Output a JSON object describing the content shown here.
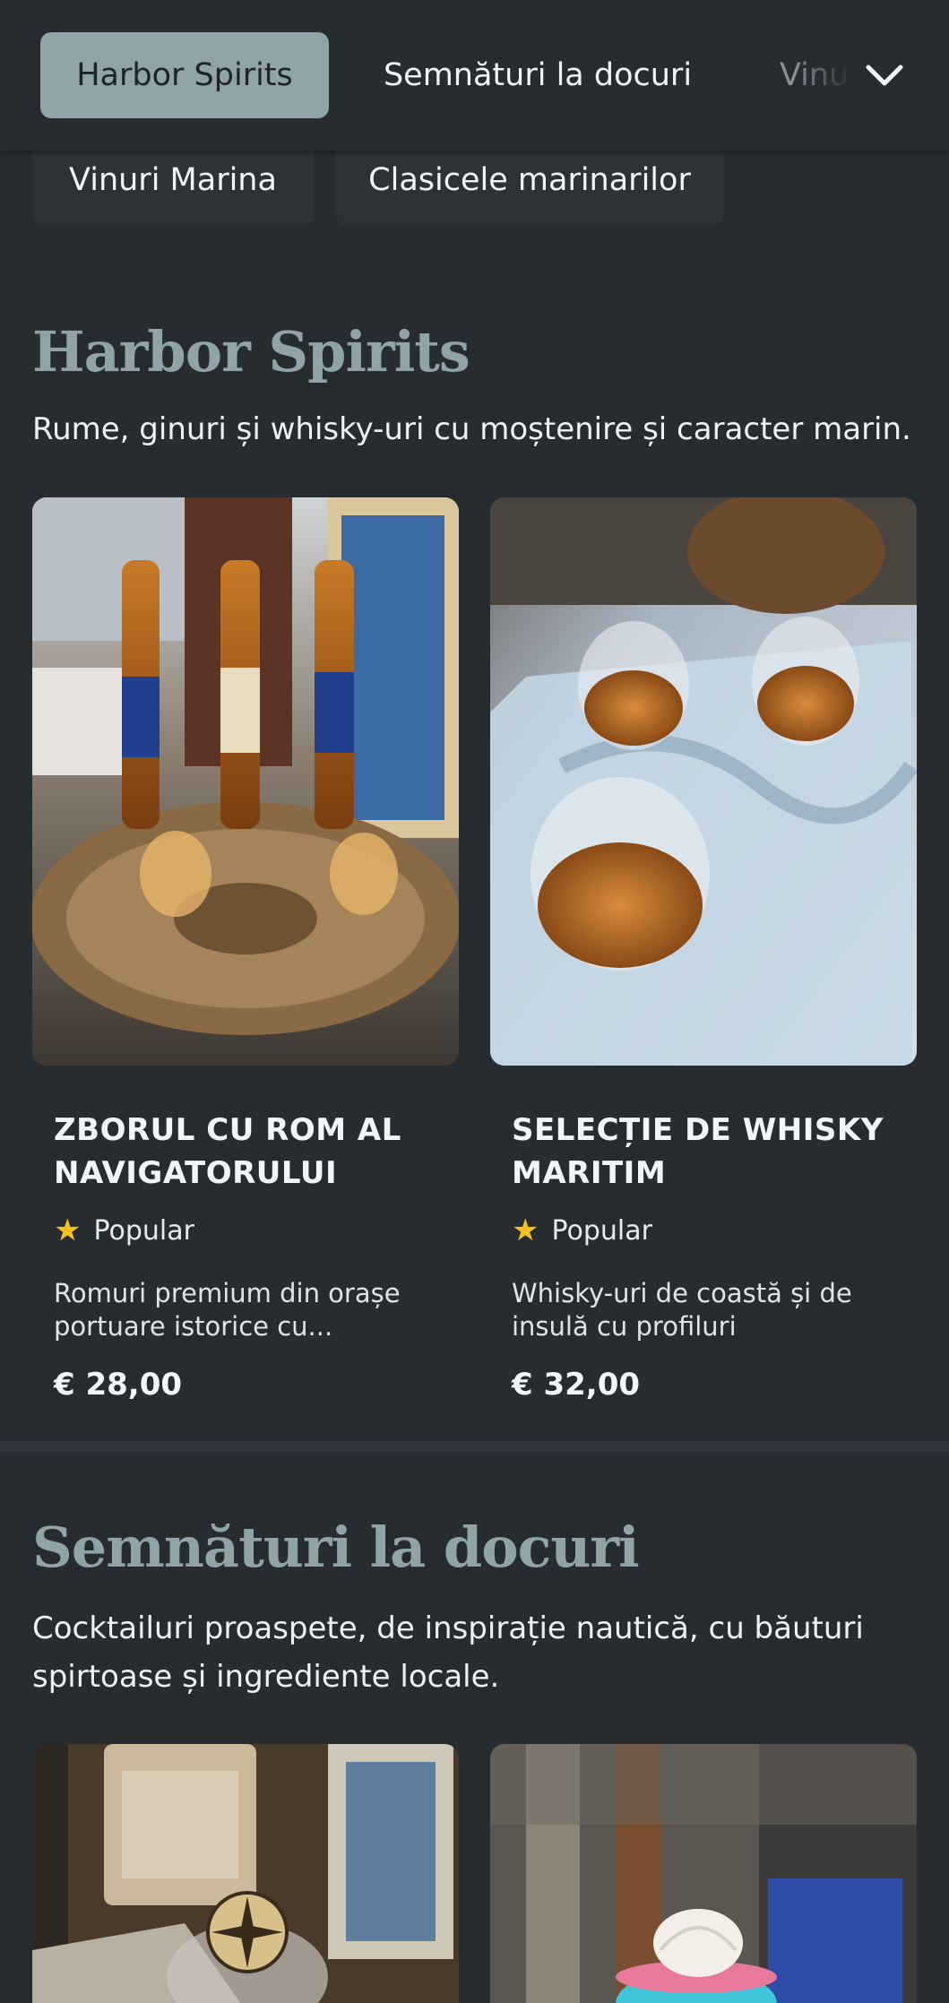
{
  "nav": {
    "tabs": [
      {
        "label": "Harbor Spirits",
        "active": true
      },
      {
        "label": "Semnături la docuri",
        "active": false
      },
      {
        "label": "Vinuri Marina",
        "active": false
      }
    ],
    "overflow_tabs": [
      "Vinuri Marina",
      "Clasicele marinarilor"
    ],
    "expand_icon": "chevron-down-icon"
  },
  "sections": [
    {
      "title": "Harbor Spirits",
      "description": "Rume, ginuri și whisky-uri cu moștenire și caracter marin.",
      "items": [
        {
          "name": "ZBORUL CU ROM AL NAVIGATORULUI",
          "badge": "Popular",
          "description": "Romuri premium din orașe portuare istorice cu...",
          "price": "€ 28,00",
          "image_label": "rum-flight-photo"
        },
        {
          "name": "SELECȚIE DE WHISKY MARITIM",
          "badge": "Popular",
          "description": "Whisky-uri de coastă și de insulă cu profiluri distinctive...",
          "price": "€ 32,00",
          "image_label": "whisky-selection-photo"
        }
      ]
    },
    {
      "title": "Semnături la docuri",
      "description": "Cocktailuri proaspete, de inspirație nautică, cu băuturi spirtoase și ingrediente locale.",
      "items": [
        {
          "image_label": "compass-cocktail-photo"
        },
        {
          "image_label": "seashell-cocktail-photo"
        }
      ]
    }
  ],
  "colors": {
    "background": "#272c31",
    "accent": "#8fa3a8",
    "star": "#f4c21b"
  }
}
